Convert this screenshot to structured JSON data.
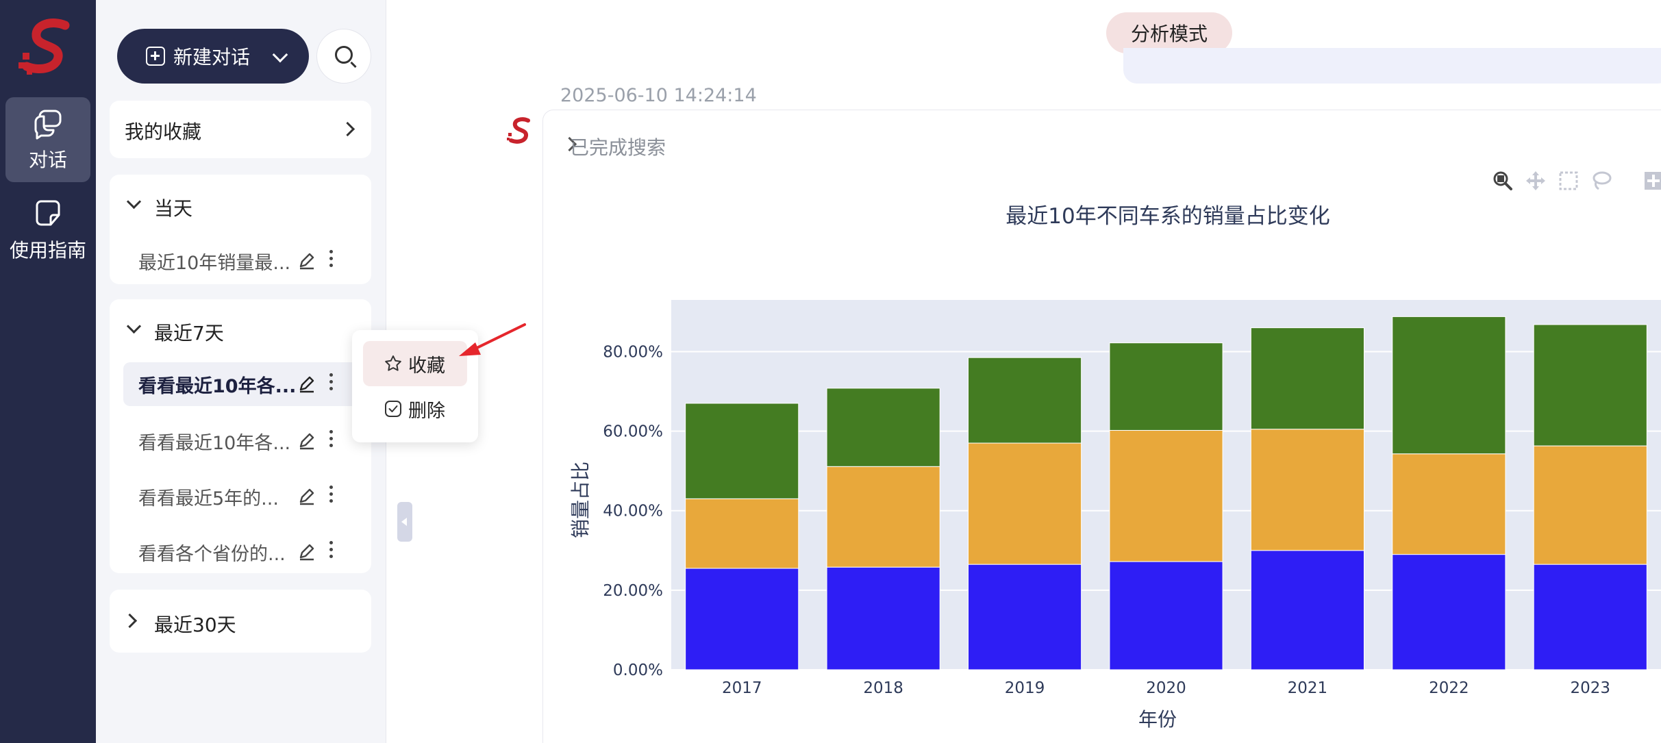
{
  "rail": {
    "items": [
      {
        "label": "对话",
        "icon": "chat-icon",
        "active": true
      },
      {
        "label": "使用指南",
        "icon": "guide-icon",
        "active": false
      }
    ],
    "brand_color": "#c8232c"
  },
  "sidebar": {
    "new_chat_label": "新建对话",
    "favorites_label": "我的收藏",
    "sections": [
      {
        "title": "当天",
        "expanded": true,
        "items": [
          "最近10年销量最..."
        ]
      },
      {
        "title": "最近7天",
        "expanded": true,
        "items": [
          "看看最近10年各...",
          "看看最近10年各...",
          "看看最近5年的...",
          "看看各个省份的..."
        ]
      },
      {
        "title": "最近30天",
        "expanded": false,
        "items": []
      }
    ]
  },
  "context_menu": {
    "items": [
      {
        "label": "收藏",
        "icon": "star-icon"
      },
      {
        "label": "删除",
        "icon": "checkbox-icon"
      }
    ]
  },
  "main": {
    "mode_label": "分析模式",
    "timestamp": "2025-06-10 14:24:14",
    "search_status": "已完成搜索"
  },
  "chart_data": {
    "type": "bar",
    "stacked": true,
    "title": "最近10年不同车系的销量占比变化",
    "xlabel": "年份",
    "ylabel": "销量占比",
    "categories": [
      "2017",
      "2018",
      "2019",
      "2020",
      "2021",
      "2022",
      "2023"
    ],
    "series": [
      {
        "color": "#2e1ef5",
        "values": [
          25.5,
          25.8,
          26.5,
          27.2,
          30.0,
          29.0,
          26.5
        ]
      },
      {
        "color": "#e8a83b",
        "values": [
          17.5,
          25.3,
          30.5,
          33.0,
          30.5,
          25.3,
          29.8
        ]
      },
      {
        "color": "#447c22",
        "values": [
          24.0,
          19.7,
          21.5,
          22.0,
          25.5,
          34.5,
          30.5
        ]
      }
    ],
    "ylim": [
      0,
      93
    ],
    "yticks": [
      0,
      20,
      40,
      60,
      80
    ],
    "ytick_labels": [
      "0.00%",
      "20.00%",
      "40.00%",
      "60.00%",
      "80.00%"
    ],
    "grid": true,
    "plot_bg": "#e5e9f3"
  }
}
